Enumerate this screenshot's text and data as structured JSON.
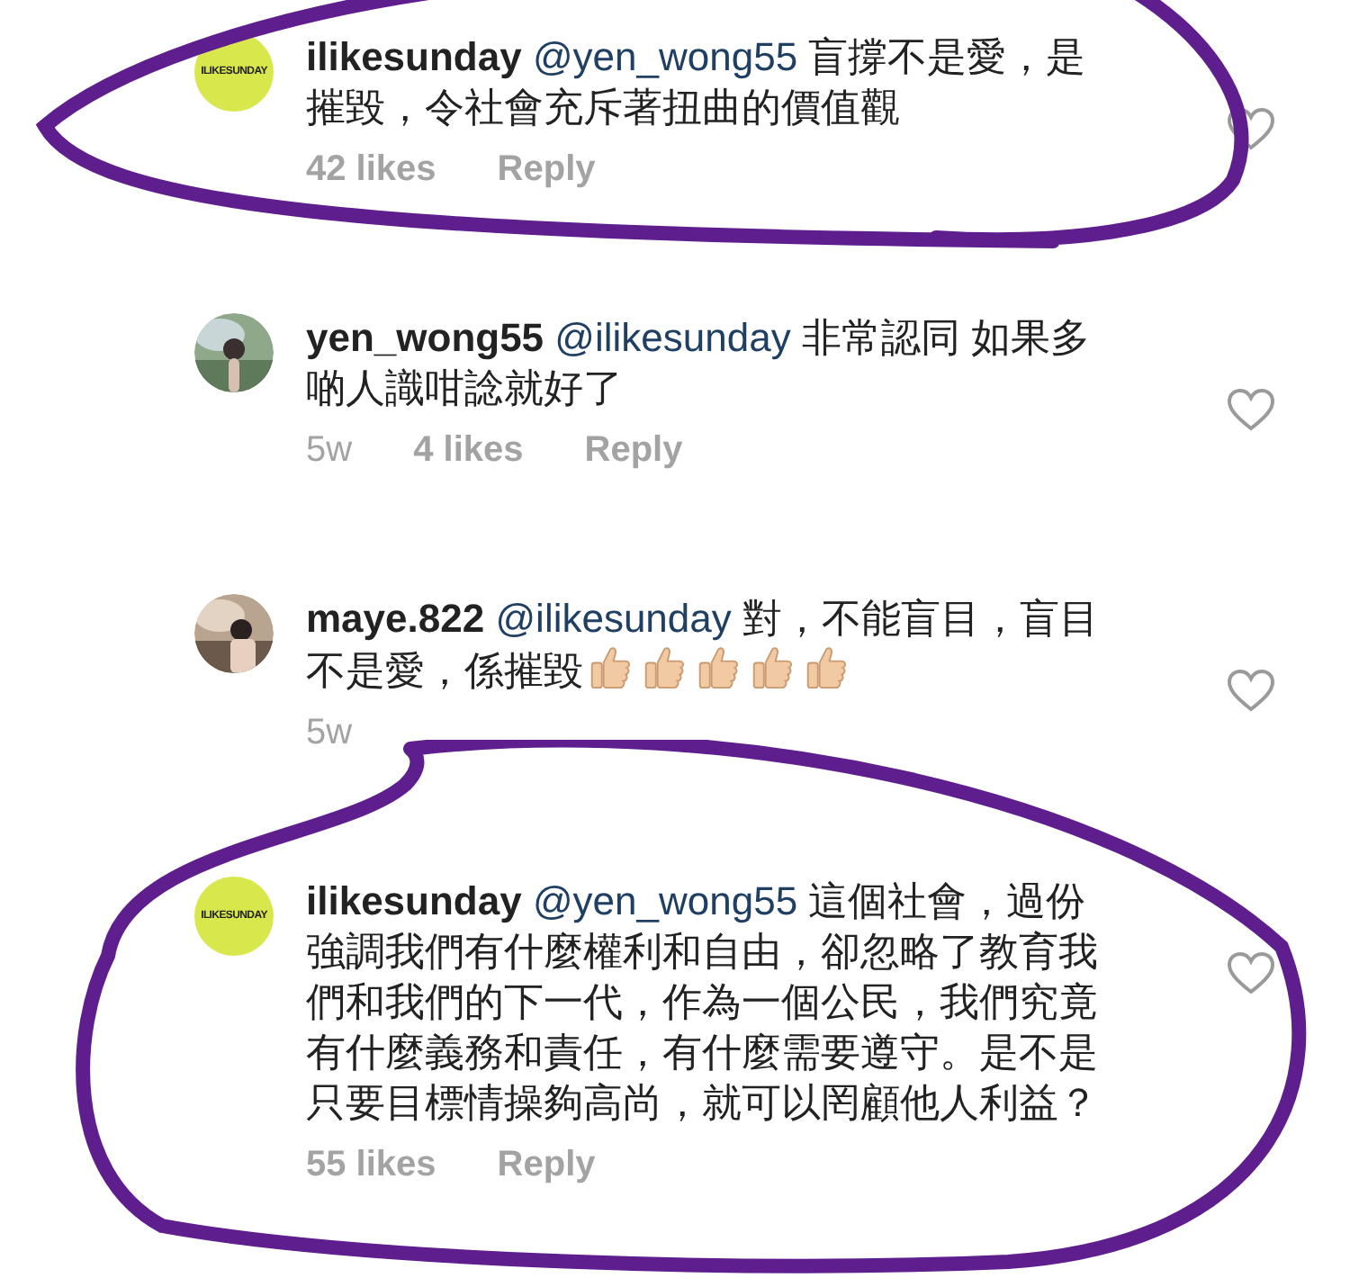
{
  "comments": [
    {
      "username": "ilikesunday",
      "mention": "@yen_wong55",
      "text": "盲撐不是愛，是摧毀，令社會充斥著扭曲的價值觀",
      "avatar": {
        "kind": "logo",
        "label": "ILIKESUNDAY"
      },
      "likes": "42 likes",
      "reply": "Reply",
      "highlight": {
        "kind": "swoosh"
      }
    },
    {
      "username": "yen_wong55",
      "mention": "@ilikesunday",
      "text": "非常認同 如果多啲人識咁諗就好了",
      "time": "5w",
      "likes": "4 likes",
      "reply": "Reply"
    },
    {
      "username": "maye.822",
      "mention": "@ilikesunday",
      "text": "對，不能盲目，盲目不是愛，係摧毀",
      "emoji": [
        {
          "kind": "thumbs-up"
        },
        {
          "kind": "thumbs-up"
        },
        {
          "kind": "thumbs-up"
        },
        {
          "kind": "thumbs-up"
        },
        {
          "kind": "thumbs-up"
        }
      ],
      "time": "5w"
    },
    {
      "username": "ilikesunday",
      "mention": "@yen_wong55",
      "text": "這個社會，過份強調我們有什麼權利和自由，卻忽略了教育我們和我們的下一代，作為一個公民，我們究竟有什麼義務和責任，有什麼需要遵守。是不是只要目標情操夠高尚，就可以罔顧他人利益？",
      "avatar": {
        "kind": "logo",
        "label": "ILIKESUNDAY"
      },
      "likes": "55 likes",
      "reply": "Reply",
      "highlight": {
        "kind": "oval"
      }
    }
  ]
}
